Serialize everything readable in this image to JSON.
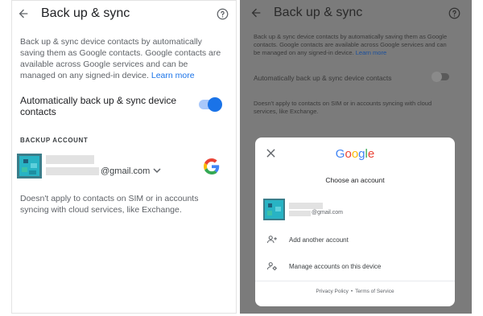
{
  "left": {
    "header": {
      "title": "Back up & sync"
    },
    "description": "Back up & sync device contacts by automatically saving them as Google contacts. Google contacts are available across Google services and can be managed on any signed-in device.",
    "learn_more": "Learn more",
    "toggle": {
      "label": "Automatically back up & sync device contacts",
      "state": "on"
    },
    "backup_account_label": "BACKUP ACCOUNT",
    "account": {
      "email_suffix": "@gmail.com"
    },
    "footnote": "Doesn't apply to contacts on SIM or in accounts syncing with cloud services, like Exchange."
  },
  "right": {
    "header": {
      "title": "Back up & sync"
    },
    "description": "Back up & sync device contacts by automatically saving them as Google contacts. Google contacts are available across Google services and can be managed on any signed-in device.",
    "learn_more": "Learn more",
    "toggle": {
      "label": "Automatically back up & sync device contacts",
      "state": "off"
    },
    "footnote": "Doesn't apply to contacts on SIM or in accounts syncing with cloud services, like Exchange.",
    "dialog": {
      "brand": "Google",
      "subtitle": "Choose an account",
      "account_email_suffix": "@gmail.com",
      "add_account": "Add another account",
      "manage_accounts": "Manage accounts on this device",
      "privacy_policy": "Privacy Policy",
      "separator": "•",
      "terms": "Terms of Service"
    }
  },
  "colors": {
    "accent": "#1a73e8",
    "overlay_background": "#7b7b7b",
    "google_blue": "#4285f4",
    "google_red": "#ea4335",
    "google_yellow": "#fbbc05",
    "google_green": "#34a853"
  },
  "icons": [
    "back-arrow-icon",
    "help-icon",
    "chevron-down-icon",
    "google-g-icon",
    "close-icon",
    "person-add-icon",
    "manage-accounts-icon"
  ]
}
